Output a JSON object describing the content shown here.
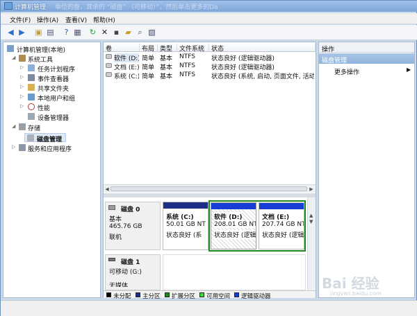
{
  "window": {
    "title": "计算机管理",
    "title_blur": "单位的盘，其余的 “磁盘” （可移动）”，然后单击更多的Da"
  },
  "menu": [
    "文件(F)",
    "操作(A)",
    "查看(V)",
    "帮助(H)"
  ],
  "toolbar_icons": [
    "back-icon",
    "forward-icon",
    "up-folder-icon",
    "list-icon",
    "help-icon",
    "properties-icon",
    "refresh-icon",
    "delete-icon",
    "open-icon",
    "folder-icon",
    "search-icon",
    "export-icon"
  ],
  "tree": {
    "root": "计算机管理(本地)",
    "system_tools": "系统工具",
    "task_scheduler": "任务计划程序",
    "event_viewer": "事件查看器",
    "shared_folders": "共享文件夹",
    "local_users": "本地用户和组",
    "performance": "性能",
    "device_manager": "设备管理器",
    "storage": "存储",
    "disk_management": "磁盘管理",
    "services": "服务和应用程序"
  },
  "volume_table": {
    "headers": [
      "卷",
      "布局",
      "类型",
      "文件系统",
      "状态"
    ],
    "rows": [
      {
        "volume": "软件 (D:)",
        "layout": "简单",
        "type": "基本",
        "fs": "NTFS",
        "status": "状态良好 (逻辑驱动器)"
      },
      {
        "volume": "文档 (E:)",
        "layout": "简单",
        "type": "基本",
        "fs": "NTFS",
        "status": "状态良好 (逻辑驱动器)"
      },
      {
        "volume": "系统 (C:)",
        "layout": "简单",
        "type": "基本",
        "fs": "NTFS",
        "status": "状态良好 (系统, 启动, 页面文件, 活动, 故"
      }
    ]
  },
  "disks": [
    {
      "name": "磁盘 0",
      "type": "基本",
      "size": "465.76 GB",
      "state": "联机",
      "partitions": [
        {
          "name": "系统 (C:)",
          "size": "50.01 GB NT",
          "status": "状态良好 (系"
        },
        {
          "name": "软件 (D:)",
          "size": "208.01 GB NT",
          "status": "状态良好 (逻辑"
        },
        {
          "name": "文档 (E:)",
          "size": "207.74 GB NT",
          "status": "状态良好 (逻辑"
        }
      ]
    },
    {
      "name": "磁盘 1",
      "type": "可移动 (G:)",
      "extra": "无媒体"
    }
  ],
  "legend": [
    {
      "label": "未分配",
      "color": "#000000"
    },
    {
      "label": "主分区",
      "color": "#1d2f86"
    },
    {
      "label": "扩展分区",
      "color": "#1e8a1e"
    },
    {
      "label": "可用空间",
      "color": "#3fd63f"
    },
    {
      "label": "逻辑驱动器",
      "color": "#1a3cd6"
    }
  ],
  "actions": {
    "header": "操作",
    "selected": "磁盘管理",
    "more": "更多操作"
  },
  "watermark": {
    "text": "Bai 经验",
    "url": "jingyan.baidu.com"
  }
}
